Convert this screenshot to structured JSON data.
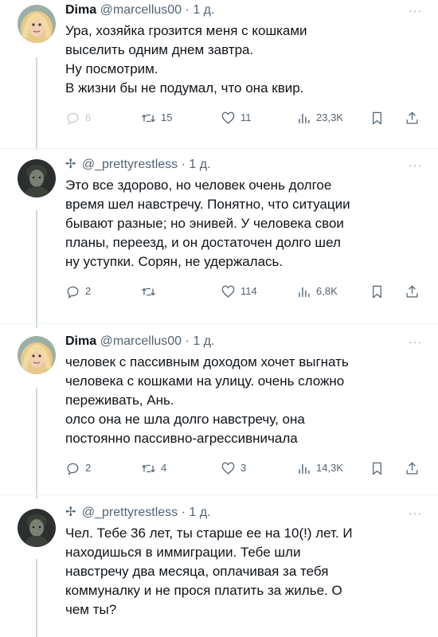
{
  "tweets": [
    {
      "author_name": "Dima",
      "handle": "@marcellus00",
      "sep": "·",
      "time": "1 д.",
      "more": "···",
      "lines": [
        "Ура, хозяйка грозится меня с кошками",
        "выселить одним днем завтра.",
        "Ну посмотрим.",
        "В жизни бы не подумал, что она квир."
      ],
      "stats": {
        "replies": "6",
        "retweets": "15",
        "likes": "11",
        "views": "23,3K"
      }
    },
    {
      "author_glyph": "✢",
      "handle": "@_prettyrestless",
      "sep": "·",
      "time": "1 д.",
      "more": "···",
      "lines": [
        "Это все здорово, но человек очень долгое",
        "время шел навстречу. Понятно, что ситуации",
        "бывают разные; но энивей. У человека свои",
        "планы, переезд, и он достаточен долго шел",
        "ну уступки. Сорян, не удержалась."
      ],
      "stats": {
        "replies": "2",
        "retweets": "",
        "likes": "114",
        "views": "6,8K"
      }
    },
    {
      "author_name": "Dima",
      "handle": "@marcellus00",
      "sep": "·",
      "time": "1 д.",
      "more": "···",
      "lines": [
        "человек с пассивным доходом хочет выгнать",
        "человека с кошками на улицу. очень сложно",
        "переживать, Ань.",
        "олсо она не шла долго навстречу, она",
        "постоянно пассивно-агрессивничала"
      ],
      "stats": {
        "replies": "2",
        "retweets": "4",
        "likes": "3",
        "views": "14,3K"
      }
    },
    {
      "author_glyph": "✢",
      "handle": "@_prettyrestless",
      "sep": "·",
      "time": "1 д.",
      "more": "···",
      "lines": [
        "Чел. Тебе 36 лет, ты старше ее на 10(!) лет. И",
        "находишься в иммиграции. Тебе шли",
        "навстречу два месяца, оплачивая за тебя",
        "коммуналку и не прося платить за жилье. О",
        "чем ты?"
      ]
    }
  ],
  "icons": {
    "reply": "reply-icon",
    "retweet": "retweet-icon",
    "like": "heart-icon",
    "views": "views-icon",
    "bookmark": "bookmark-icon",
    "share": "share-icon"
  },
  "colors": {
    "text": "#0f1419",
    "secondary": "#536471",
    "thread_line": "#cfd9de"
  }
}
